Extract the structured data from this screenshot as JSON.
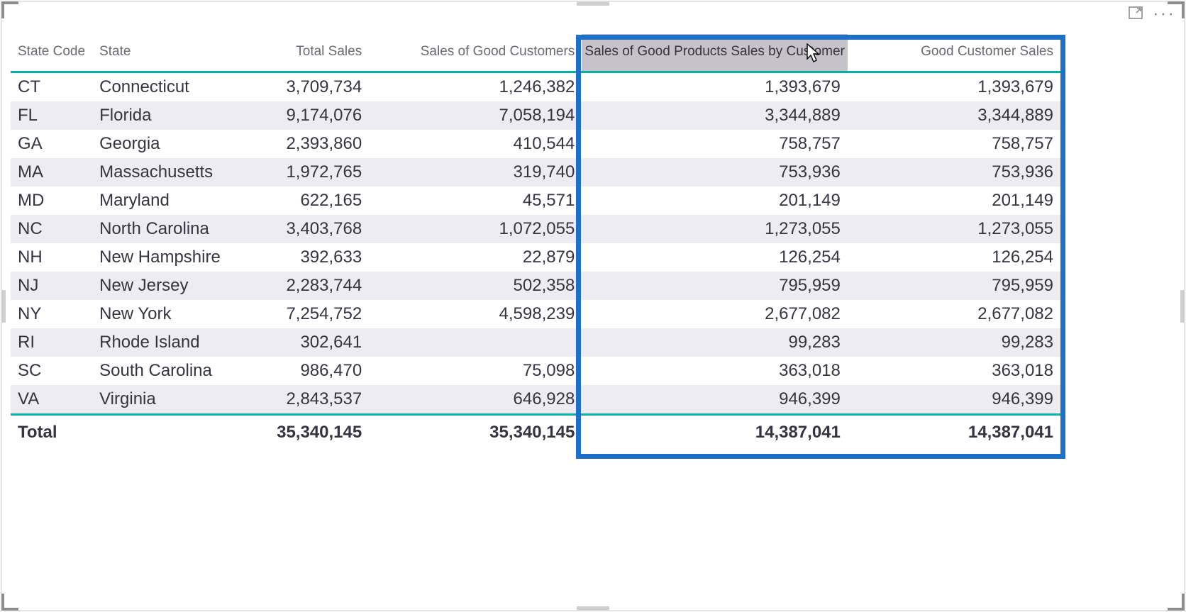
{
  "header": {
    "cols": [
      {
        "id": "state_code",
        "label": "State Code",
        "num": false,
        "cls": "c-code"
      },
      {
        "id": "state",
        "label": "State",
        "num": false,
        "cls": "c-state"
      },
      {
        "id": "total",
        "label": "Total Sales",
        "num": true,
        "cls": "c-total"
      },
      {
        "id": "good1",
        "label": "Sales of Good Customers",
        "num": true,
        "cls": "c-good"
      },
      {
        "id": "good2",
        "label": "Sales of Good Products Sales by Customer",
        "num": true,
        "cls": "c-good2",
        "selected": true
      },
      {
        "id": "good3",
        "label": "Good Customer Sales",
        "num": true,
        "cls": "c-good3"
      }
    ]
  },
  "rows": [
    {
      "code": "CT",
      "state": "Connecticut",
      "total": "3,709,734",
      "good1": "1,246,382",
      "good2": "1,393,679",
      "good3": "1,393,679"
    },
    {
      "code": "FL",
      "state": "Florida",
      "total": "9,174,076",
      "good1": "7,058,194",
      "good2": "3,344,889",
      "good3": "3,344,889"
    },
    {
      "code": "GA",
      "state": "Georgia",
      "total": "2,393,860",
      "good1": "410,544",
      "good2": "758,757",
      "good3": "758,757"
    },
    {
      "code": "MA",
      "state": "Massachusetts",
      "total": "1,972,765",
      "good1": "319,740",
      "good2": "753,936",
      "good3": "753,936"
    },
    {
      "code": "MD",
      "state": "Maryland",
      "total": "622,165",
      "good1": "45,571",
      "good2": "201,149",
      "good3": "201,149"
    },
    {
      "code": "NC",
      "state": "North Carolina",
      "total": "3,403,768",
      "good1": "1,072,055",
      "good2": "1,273,055",
      "good3": "1,273,055"
    },
    {
      "code": "NH",
      "state": "New Hampshire",
      "total": "392,633",
      "good1": "22,879",
      "good2": "126,254",
      "good3": "126,254"
    },
    {
      "code": "NJ",
      "state": "New Jersey",
      "total": "2,283,744",
      "good1": "502,358",
      "good2": "795,959",
      "good3": "795,959"
    },
    {
      "code": "NY",
      "state": "New York",
      "total": "7,254,752",
      "good1": "4,598,239",
      "good2": "2,677,082",
      "good3": "2,677,082"
    },
    {
      "code": "RI",
      "state": "Rhode Island",
      "total": "302,641",
      "good1": "",
      "good2": "99,283",
      "good3": "99,283"
    },
    {
      "code": "SC",
      "state": "South Carolina",
      "total": "986,470",
      "good1": "75,098",
      "good2": "363,018",
      "good3": "363,018"
    },
    {
      "code": "VA",
      "state": "Virginia",
      "total": "2,843,537",
      "good1": "646,928",
      "good2": "946,399",
      "good3": "946,399"
    }
  ],
  "totals": {
    "label": "Total",
    "total": "35,340,145",
    "good1": "35,340,145",
    "good2": "14,387,041",
    "good3": "14,387,041"
  },
  "chart_data": {
    "type": "table",
    "columns": [
      "State Code",
      "State",
      "Total Sales",
      "Sales of Good Customers",
      "Sales of Good Products Sales by Customer",
      "Good Customer Sales"
    ],
    "rows": [
      [
        "CT",
        "Connecticut",
        3709734,
        1246382,
        1393679,
        1393679
      ],
      [
        "FL",
        "Florida",
        9174076,
        7058194,
        3344889,
        3344889
      ],
      [
        "GA",
        "Georgia",
        2393860,
        410544,
        758757,
        758757
      ],
      [
        "MA",
        "Massachusetts",
        1972765,
        319740,
        753936,
        753936
      ],
      [
        "MD",
        "Maryland",
        622165,
        45571,
        201149,
        201149
      ],
      [
        "NC",
        "North Carolina",
        3403768,
        1072055,
        1273055,
        1273055
      ],
      [
        "NH",
        "New Hampshire",
        392633,
        22879,
        126254,
        126254
      ],
      [
        "NJ",
        "New Jersey",
        2283744,
        502358,
        795959,
        795959
      ],
      [
        "NY",
        "New York",
        7254752,
        4598239,
        2677082,
        2677082
      ],
      [
        "RI",
        "Rhode Island",
        302641,
        null,
        99283,
        99283
      ],
      [
        "SC",
        "South Carolina",
        986470,
        75098,
        363018,
        363018
      ],
      [
        "VA",
        "Virginia",
        2843537,
        646928,
        946399,
        946399
      ]
    ],
    "totals": [
      "Total",
      "",
      35340145,
      35340145,
      14387041,
      14387041
    ]
  }
}
